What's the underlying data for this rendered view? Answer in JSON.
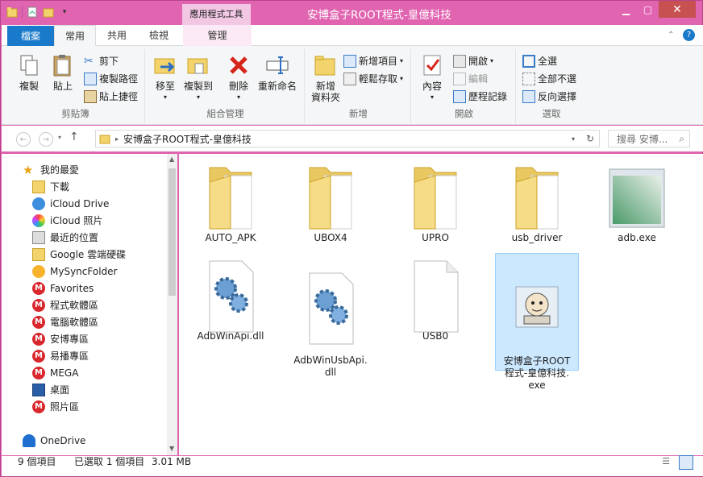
{
  "window": {
    "title": "安博盒子ROOT程式-皇億科技",
    "context_tab": "應用程式工具"
  },
  "colors": {
    "accent": "#e064b0",
    "file_tab": "#1979ca",
    "selection": "#cce8ff"
  },
  "tabs": [
    {
      "label": "檔案"
    },
    {
      "label": "常用"
    },
    {
      "label": "共用"
    },
    {
      "label": "檢視"
    },
    {
      "label": "管理"
    }
  ],
  "ribbon": {
    "clipboard": {
      "label": "剪貼簿",
      "copy": "複製",
      "paste": "貼上",
      "cut": "剪下",
      "copy_path": "複製路徑",
      "paste_shortcut": "貼上捷徑"
    },
    "organize": {
      "label": "組合管理",
      "move_to": "移至",
      "copy_to": "複製到",
      "delete": "刪除",
      "rename": "重新命名"
    },
    "new": {
      "label": "新增",
      "new_folder_1": "新增",
      "new_folder_2": "資料夾",
      "new_item": "新增項目",
      "easy_access": "輕鬆存取"
    },
    "open": {
      "label": "開啟",
      "properties": "內容",
      "open": "開啟",
      "edit": "編輯",
      "history": "歷程記錄"
    },
    "select": {
      "label": "選取",
      "select_all": "全選",
      "select_none": "全部不選",
      "invert": "反向選擇"
    }
  },
  "address": {
    "path": "安博盒子ROOT程式-皇億科技",
    "search_placeholder": "搜尋 安博..."
  },
  "nav": {
    "favorites": "我的最愛",
    "items": [
      "下載",
      "iCloud Drive",
      "iCloud 照片",
      "最近的位置",
      "Google 雲端硬碟",
      "MySyncFolder",
      "Favorites",
      "程式軟體區",
      "電腦軟體區",
      "安博專區",
      "易播專區",
      "MEGA",
      "桌面",
      "照片區"
    ],
    "onedrive": "OneDrive"
  },
  "files": [
    "AUTO_APK",
    "UBOX4",
    "UPRO",
    "usb_driver",
    "adb.exe",
    "AdbWinApi.dll",
    "AdbWinUsbApi.\ndll",
    "USB0",
    "安博盒子ROOT\n程式-皇億科技.\nexe"
  ],
  "status": {
    "count": "9 個項目",
    "selected": "已選取 1 個項目",
    "size": "3.01 MB"
  }
}
